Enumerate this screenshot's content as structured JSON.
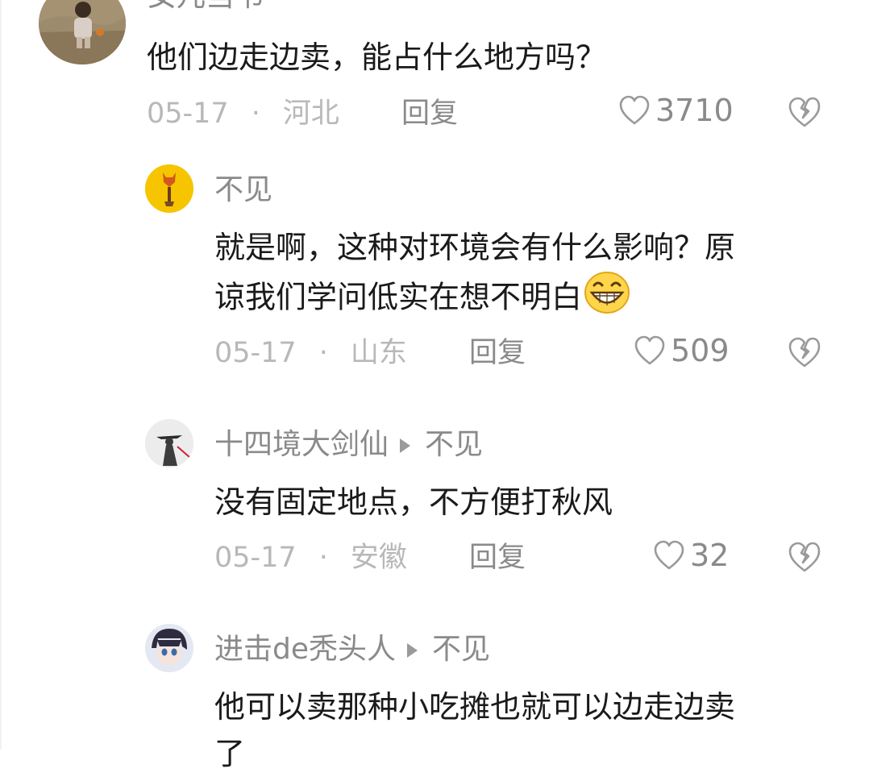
{
  "comments": [
    {
      "name": "女儿当书",
      "text": "他们边走边卖，能占什么地方吗？",
      "date": "05-17",
      "location": "河北",
      "reply_label": "回复",
      "likes": "3710"
    },
    {
      "name": "不见",
      "text_line1": "就是啊，这种对环境会有什么影响？原",
      "text_line2": "谅我们学问低实在想不明白",
      "date": "05-17",
      "location": "山东",
      "reply_label": "回复",
      "likes": "509"
    },
    {
      "name": "十四境大剑仙",
      "reply_to": "不见",
      "text": "没有固定地点，不方便打秋风",
      "date": "05-17",
      "location": "安徽",
      "reply_label": "回复",
      "likes": "32"
    },
    {
      "name": "进击de秃头人",
      "reply_to": "不见",
      "text_line1": "他可以卖那种小吃摊也就可以边走边卖",
      "text_line2": "了"
    }
  ],
  "meta_separator": "·",
  "icons": {
    "like": "heart-outline-icon",
    "dislike": "broken-heart-icon",
    "reply_arrow": "triangle-right-icon",
    "emoji": "grinning-face-emoji"
  },
  "colors": {
    "text": "#1a1a1a",
    "name": "#8a8a8a",
    "meta": "#b8b8b8"
  }
}
